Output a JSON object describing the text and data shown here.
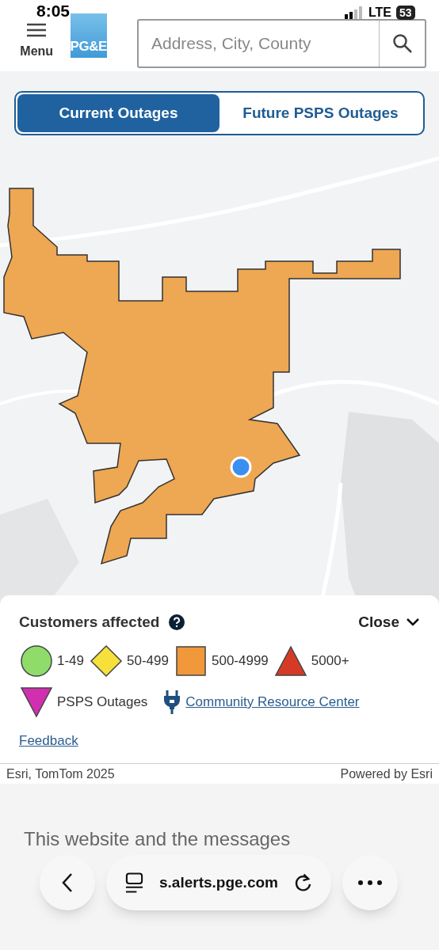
{
  "status_bar": {
    "time": "8:05",
    "network": "LTE",
    "battery": "53"
  },
  "header": {
    "menu_label": "Menu",
    "logo": "PG&E",
    "search": {
      "placeholder": "Address, City, County"
    }
  },
  "tabs": [
    {
      "label": "Current Outages",
      "selected": true
    },
    {
      "label": "Future PSPS Outages",
      "selected": false
    }
  ],
  "legend": {
    "title": "Customers affected",
    "close_label": "Close",
    "items": [
      {
        "kind": "circle",
        "label": "1-49",
        "color": "#8fdc6a"
      },
      {
        "kind": "diamond",
        "label": "50-499",
        "color": "#f7e03c"
      },
      {
        "kind": "square",
        "label": "500-4999",
        "color": "#f0983a"
      },
      {
        "kind": "triangle",
        "label": "5000+",
        "color": "#d63a26"
      },
      {
        "kind": "inverted-triangle",
        "label": "PSPS Outages",
        "color": "#d12fb0"
      }
    ],
    "link": "Community Resource Center",
    "feedback": "Feedback"
  },
  "attribution": {
    "left": "Esri, TomTom 2025",
    "right": "Powered by Esri"
  },
  "footer_text": "This website and the messages",
  "browser_bar": {
    "url": "s.alerts.pge.com"
  }
}
